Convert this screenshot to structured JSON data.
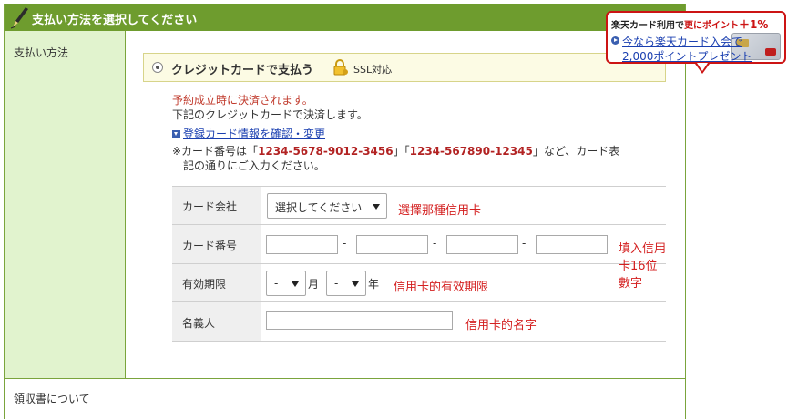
{
  "header": {
    "title": "支払い方法を選択してください"
  },
  "sidebar": {
    "payment_label": "支払い方法"
  },
  "payment_option": {
    "title": "クレジットカードで支払う",
    "ssl": "SSL対応",
    "selected": true
  },
  "messages": {
    "red_notice": "予約成立時に決済されます。",
    "line1": "下記のクレジットカードで決済します。",
    "link": "登録カード情報を確認・変更",
    "note_prefix": "※カード番号は「",
    "example1": "1234-5678-9012-3456",
    "note_mid": "」「",
    "example2": "1234-567890-12345",
    "note_suffix": "」など、カード表",
    "note_line2": "記の通りにご入力ください。"
  },
  "form": {
    "card_company": {
      "label": "カード会社",
      "value": "選択してください",
      "annotation": "選擇那種信用卡"
    },
    "card_number": {
      "label": "カード番号",
      "separator": "-",
      "annotation": "填入信用卡16位數字"
    },
    "expiry": {
      "label": "有効期限",
      "month_value": "-",
      "month_unit": "月",
      "year_value": "-",
      "year_unit": "年",
      "annotation": "信用卡的有效期限"
    },
    "holder": {
      "label": "名義人",
      "annotation": "信用卡的名字"
    }
  },
  "receipt": {
    "label": "領収書について"
  },
  "promo": {
    "headline_1": "楽天カード利用で",
    "headline_2": "更にポイント",
    "headline_3": "＋1%",
    "link_1": "今なら楽天カード入会で",
    "link_2": "2,000ポイントプレゼント"
  },
  "colors": {
    "header_green": "#6e9c2e",
    "sidebar_green": "#e1f3ce",
    "annotation_red": "#d42020",
    "promo_red": "#cc1414"
  }
}
